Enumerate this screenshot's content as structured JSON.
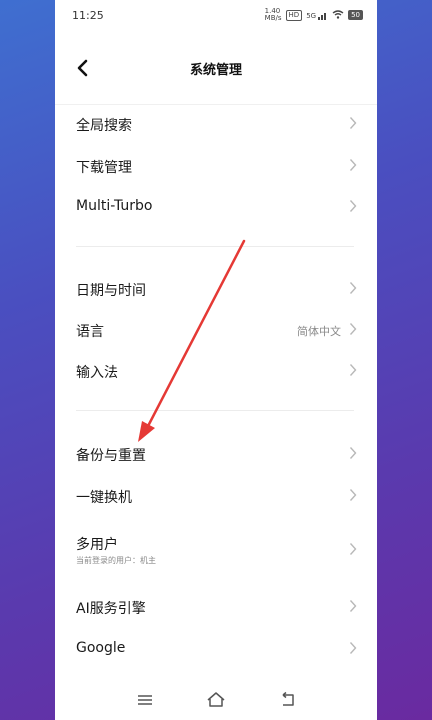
{
  "status_bar": {
    "time": "11:25",
    "net_speed_top": "1.40",
    "net_speed_unit": "MB/s",
    "hd_label": "HD",
    "signal_label": "5G",
    "battery": "50"
  },
  "header": {
    "title": "系统管理",
    "back_icon": "chevron-left-icon"
  },
  "groups": [
    {
      "items": [
        {
          "label": "全局搜索"
        },
        {
          "label": "下载管理"
        },
        {
          "label": "Multi-Turbo"
        }
      ]
    },
    {
      "items": [
        {
          "label": "日期与时间"
        },
        {
          "label": "语言",
          "value": "简体中文"
        },
        {
          "label": "输入法"
        }
      ]
    },
    {
      "items": [
        {
          "label": "备份与重置"
        },
        {
          "label": "一键换机"
        },
        {
          "label": "多用户",
          "subtitle": "当前登录的用户：机主"
        },
        {
          "label": "AI服务引擎"
        },
        {
          "label": "Google"
        }
      ]
    }
  ],
  "nav_bar": {
    "menu_icon": "menu-icon",
    "home_icon": "home-icon",
    "back_icon": "back-icon"
  },
  "annotation": {
    "arrow_color": "#e53935"
  }
}
